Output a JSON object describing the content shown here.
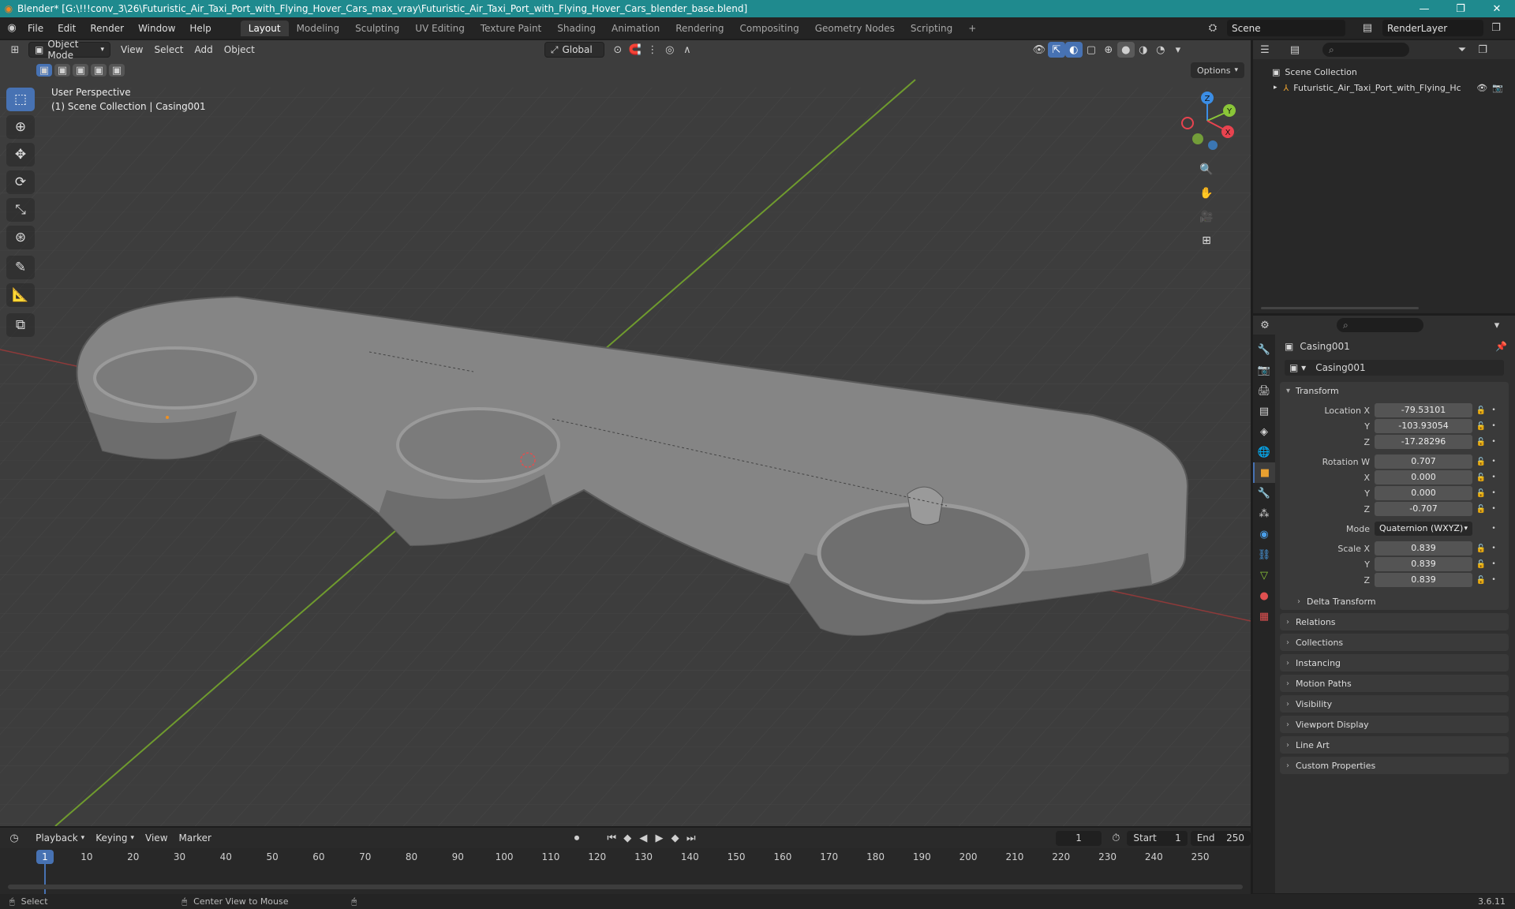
{
  "window": {
    "title": "Blender* [G:\\!!!conv_3\\26\\Futuristic_Air_Taxi_Port_with_Flying_Hover_Cars_max_vray\\Futuristic_Air_Taxi_Port_with_Flying_Hover_Cars_blender_base.blend]",
    "minimize": "—",
    "maximize": "❐",
    "close": "✕"
  },
  "menu": [
    "File",
    "Edit",
    "Render",
    "Window",
    "Help"
  ],
  "workspaces": [
    "Layout",
    "Modeling",
    "Sculpting",
    "UV Editing",
    "Texture Paint",
    "Shading",
    "Animation",
    "Rendering",
    "Compositing",
    "Geometry Nodes",
    "Scripting"
  ],
  "workspace_add": "+",
  "scene": {
    "name": "Scene",
    "render_layer": "RenderLayer"
  },
  "viewport": {
    "mode": "Object Mode",
    "menus": [
      "View",
      "Select",
      "Add",
      "Object"
    ],
    "orientation": "Global",
    "options": "Options",
    "info_line1": "User Perspective",
    "info_line2": "(1) Scene Collection | Casing001",
    "gizmo_labels": {
      "x": "X",
      "y": "Y",
      "z": "Z"
    }
  },
  "outliner": {
    "search_placeholder": "",
    "root": "Scene Collection",
    "items": [
      {
        "label": "Futuristic_Air_Taxi_Port_with_Flying_Hc"
      }
    ]
  },
  "properties": {
    "object_name": "Casing001",
    "data_name": "Casing001",
    "transform_label": "Transform",
    "location": {
      "label": "Location X",
      "x": "-79.53101",
      "y": "-103.93054",
      "z": "-17.28296"
    },
    "rotation": {
      "label": "Rotation W",
      "w": "0.707",
      "x": "0.000",
      "y": "0.000",
      "z": "-0.707"
    },
    "mode": {
      "label": "Mode",
      "value": "Quaternion (WXYZ)"
    },
    "scale": {
      "label": "Scale X",
      "x": "0.839",
      "y": "0.839",
      "z": "0.839"
    },
    "axis_labels": {
      "x": "X",
      "y": "Y",
      "z": "Z"
    },
    "delta_transform": "Delta Transform",
    "sections": [
      "Relations",
      "Collections",
      "Instancing",
      "Motion Paths",
      "Visibility",
      "Viewport Display",
      "Line Art",
      "Custom Properties"
    ]
  },
  "timeline": {
    "menus": [
      "Playback",
      "Keying",
      "View",
      "Marker"
    ],
    "current_frame": "1",
    "start_label": "Start",
    "start": "1",
    "end_label": "End",
    "end": "250",
    "ticks": [
      "10",
      "20",
      "30",
      "40",
      "50",
      "60",
      "70",
      "80",
      "90",
      "100",
      "110",
      "120",
      "130",
      "140",
      "150",
      "160",
      "170",
      "180",
      "190",
      "200",
      "210",
      "220",
      "230",
      "240",
      "250"
    ]
  },
  "status": {
    "select": "Select",
    "center_view": "Center View to Mouse",
    "version": "3.6.11"
  },
  "colors": {
    "accent": "#4772b3",
    "title_bar": "#1f8a8e",
    "x_axis": "#e8434f",
    "y_axis": "#8ac638",
    "z_axis": "#3b8ee6"
  }
}
